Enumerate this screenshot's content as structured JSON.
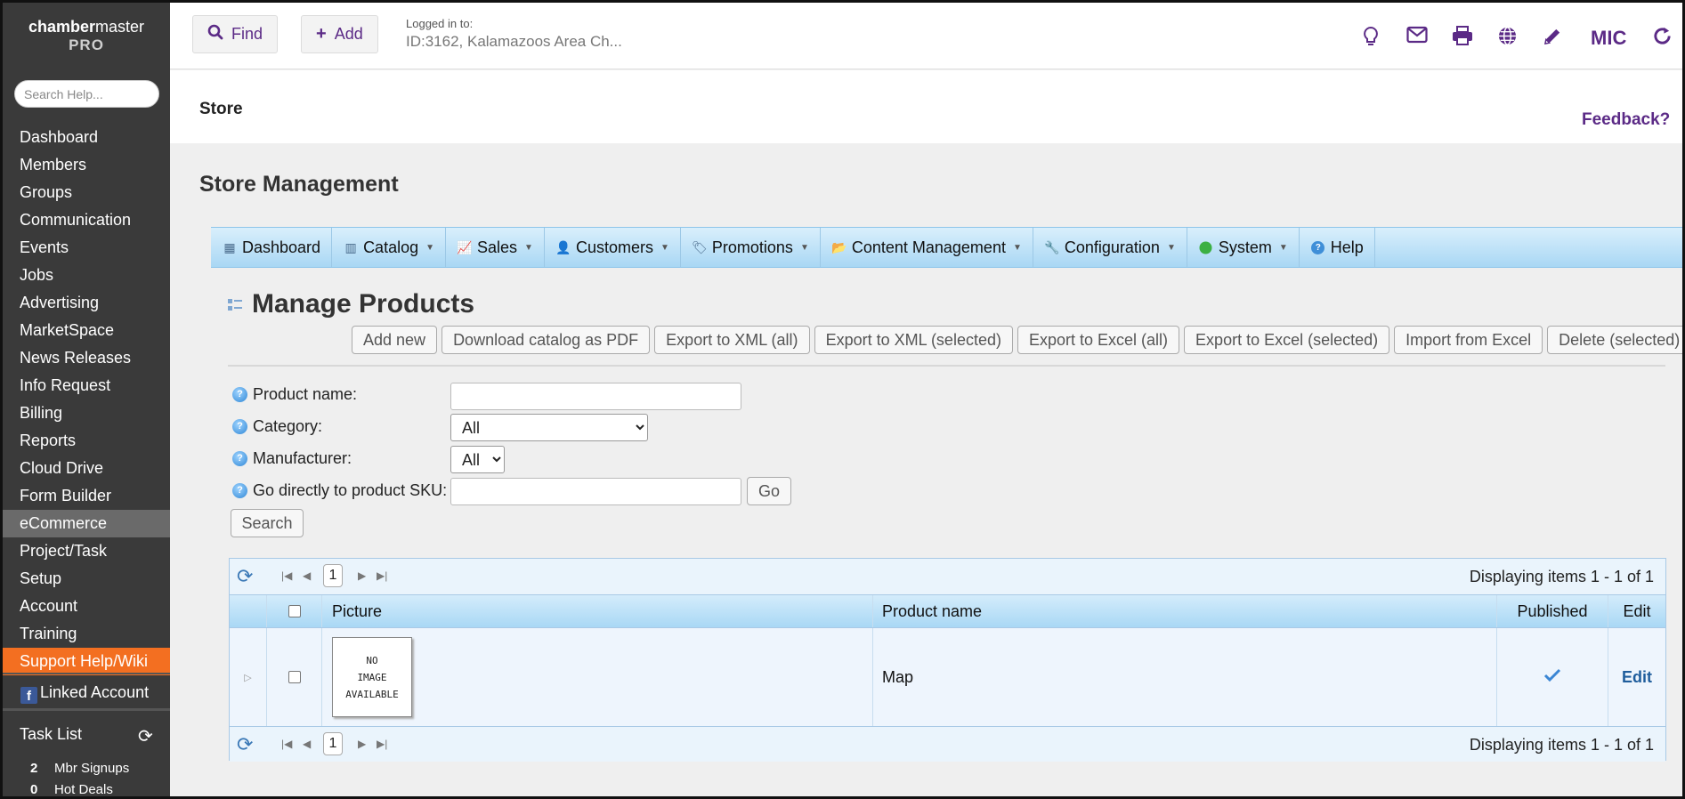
{
  "sidebar": {
    "logo_word1": "chamber",
    "logo_word2": "master",
    "logo_sub": "PRO",
    "search_placeholder": "Search Help...",
    "items": [
      "Dashboard",
      "Members",
      "Groups",
      "Communication",
      "Events",
      "Jobs",
      "Advertising",
      "MarketSpace",
      "News Releases",
      "Info Request",
      "Billing",
      "Reports",
      "Cloud Drive",
      "Form Builder",
      "eCommerce",
      "Project/Task",
      "Setup",
      "Account",
      "Training",
      "Support Help/Wiki"
    ],
    "active_item": "eCommerce",
    "linked_account": "Linked Account",
    "task_list_title": "Task List",
    "tasks": [
      {
        "count": "2",
        "label": "Mbr Signups"
      },
      {
        "count": "0",
        "label": "Hot Deals"
      }
    ]
  },
  "topbar": {
    "find_label": "Find",
    "add_label": "Add",
    "logged_in_label": "Logged in to:",
    "logged_in_value": "ID:3162, Kalamazoos Area Ch...",
    "user_initials": "MIC",
    "icons": [
      "lightbulb-icon",
      "mail-icon",
      "print-icon",
      "globe-icon",
      "pencil-icon",
      "refresh-icon"
    ]
  },
  "page": {
    "title": "Store",
    "feedback": "Feedback?",
    "section_title": "Store Management"
  },
  "menu": [
    {
      "label": "Dashboard",
      "caret": false
    },
    {
      "label": "Catalog",
      "caret": true
    },
    {
      "label": "Sales",
      "caret": true
    },
    {
      "label": "Customers",
      "caret": true
    },
    {
      "label": "Promotions",
      "caret": true
    },
    {
      "label": "Content Management",
      "caret": true
    },
    {
      "label": "Configuration",
      "caret": true
    },
    {
      "label": "System",
      "caret": true
    },
    {
      "label": "Help",
      "caret": false
    }
  ],
  "products": {
    "title": "Manage Products",
    "actions": [
      "Add new",
      "Download catalog as PDF",
      "Export to XML (all)",
      "Export to XML (selected)",
      "Export to Excel (all)",
      "Export to Excel (selected)",
      "Import from Excel",
      "Delete (selected)"
    ],
    "filters": {
      "product_name_label": "Product name:",
      "product_name_value": "",
      "category_label": "Category:",
      "category_value": "All",
      "manufacturer_label": "Manufacturer:",
      "manufacturer_value": "All",
      "sku_label": "Go directly to product SKU:",
      "sku_value": "",
      "go_label": "Go",
      "search_label": "Search"
    },
    "grid": {
      "page": "1",
      "count_text": "Displaying items 1 - 1 of 1",
      "columns": [
        "Picture",
        "Product name",
        "Published",
        "Edit"
      ],
      "rows": [
        {
          "picture_text": [
            "NO",
            "IMAGE",
            "AVAILABLE"
          ],
          "name": "Map",
          "published": true,
          "edit": "Edit"
        }
      ]
    }
  },
  "colors": {
    "brand_purple": "#5b2a86",
    "sidebar_bg": "#3a3a3a",
    "support_orange": "#f36f21"
  }
}
